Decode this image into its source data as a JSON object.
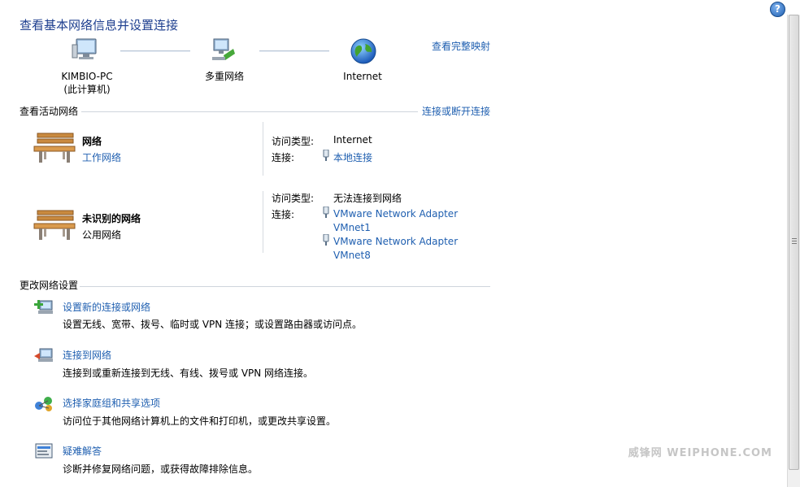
{
  "page_title": "查看基本网络信息并设置连接",
  "map": {
    "pc_name": "KIMBIO-PC",
    "pc_sub": "(此计算机)",
    "middle": "多重网络",
    "internet": "Internet",
    "full_map_link": "查看完整映射"
  },
  "active": {
    "heading": "查看活动网络",
    "connect_link": "连接或断开连接",
    "networks": [
      {
        "name": "网络",
        "type": "工作网络",
        "access_label": "访问类型:",
        "access_value": "Internet",
        "conn_label": "连接:",
        "connections": [
          "本地连接"
        ]
      },
      {
        "name": "未识别的网络",
        "type": "公用网络",
        "access_label": "访问类型:",
        "access_value": "无法连接到网络",
        "conn_label": "连接:",
        "connections": [
          {
            "line1": "VMware Network Adapter",
            "line2": "VMnet1"
          },
          {
            "line1": "VMware Network Adapter",
            "line2": "VMnet8"
          }
        ]
      }
    ]
  },
  "change": {
    "heading": "更改网络设置",
    "tasks": [
      {
        "title": "设置新的连接或网络",
        "desc": "设置无线、宽带、拨号、临时或 VPN 连接；或设置路由器或访问点。"
      },
      {
        "title": "连接到网络",
        "desc": "连接到或重新连接到无线、有线、拨号或 VPN 网络连接。"
      },
      {
        "title": "选择家庭组和共享选项",
        "desc": "访问位于其他网络计算机上的文件和打印机，或更改共享设置。"
      },
      {
        "title": "疑难解答",
        "desc": "诊断并修复网络问题，或获得故障排除信息。"
      }
    ]
  },
  "help": "?",
  "watermark": "威锋网 WEIPHONE.COM",
  "colors": {
    "link": "#1f5fb0",
    "title": "#1e3f8f"
  }
}
